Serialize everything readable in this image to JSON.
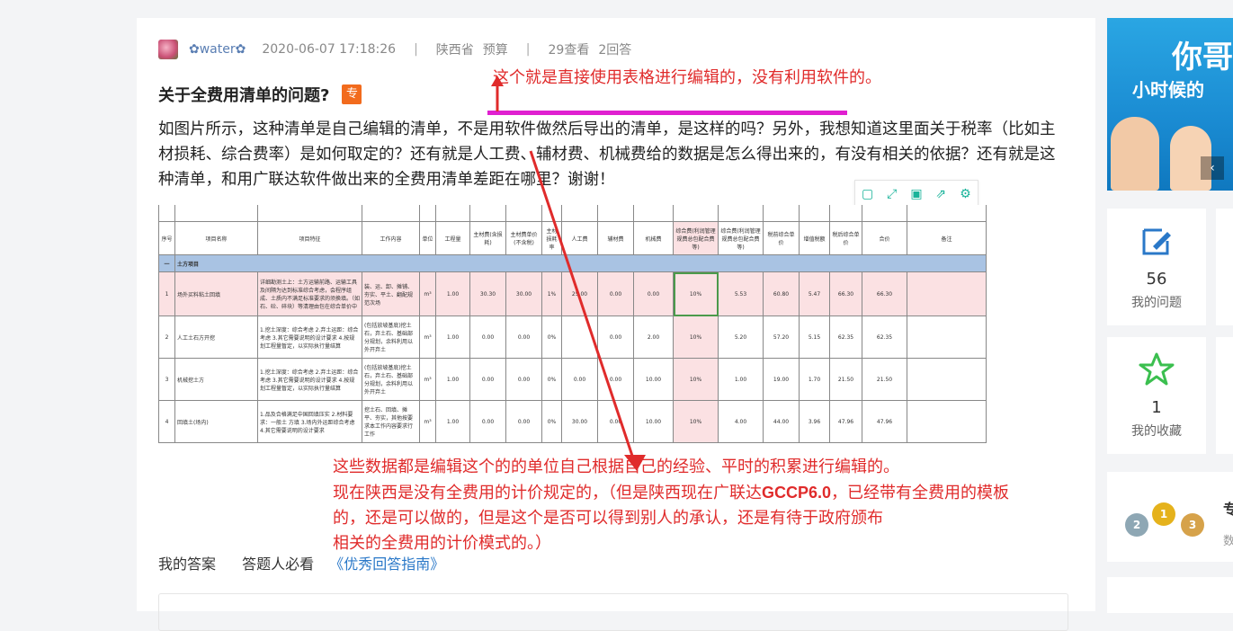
{
  "question": {
    "user": "✿water✿",
    "datetime": "2020-06-07 17:18:26",
    "region": "陕西省",
    "category": "预算",
    "views": "29查看",
    "answers": "2回答",
    "title": "关于全费用清单的问题?",
    "badge": "专",
    "body": "如图片所示，这种清单是自己编辑的清单，不是用软件做然后导出的清单，是这样的吗？另外，我想知道这里面关于税率（比如主材损耗、综合费率）是如何取定的？还有就是人工费、辅材费、机械费给的数据是怎么得出来的，有没有相关的依据？还有就是这种清单，和用广联达软件做出来的全费用清单差距在哪里？谢谢！"
  },
  "annotations": {
    "top": "这个就是直接使用表格进行编辑的，没有利用软件的。",
    "bottom_line1": "这些数据都是编辑这个的的单位自己根据自己的经验、平时的积累进行编辑的。",
    "bottom_line2a": "现在陕西是没有全费用的计价规定的，（但是陕西现在广联达",
    "bottom_line2b": "GCCP6.0",
    "bottom_line2c": "，已经带有全费用的模板",
    "bottom_line3": "的，还是可以做的，但是这个是否可以得到别人的承认，还是有待于政府颁布",
    "bottom_line4": "相关的全费用的计价模式的。）"
  },
  "toolbar_icons": [
    "copy-icon",
    "fullscreen-icon",
    "save-icon",
    "share-icon",
    "settings-icon"
  ],
  "sheet": {
    "headers": [
      "序号",
      "项目名称",
      "项目特征",
      "工作内容",
      "单位",
      "工程量",
      "主材费(含损耗)",
      "主材费单价(不含税)",
      "主材损耗率",
      "人工费",
      "辅材费",
      "机械费",
      "综合费(利润管理规费总包配合费等)",
      "综合费(利润管理规费总包配合费等)",
      "税前综合单价",
      "增值税额",
      "税后综合单价",
      "合价",
      "备注"
    ],
    "category": "土方项目",
    "category_no": "一",
    "rows": [
      [
        "1",
        "场外买料粘土回填",
        "详细勘测土上：土方运输前路、运输工具及间隔为达到标准综合考虑，会程序组成、土质内不满足标准要求的须换填。（如石、砼、碎块）等清理由包在综合单价中",
        "装、运、卸、摊铺、夯实、平土、翻配规范次场",
        "m³",
        "1.00",
        "30.30",
        "30.00",
        "1%",
        "25.00",
        "0.00",
        "0.00",
        "10%",
        "5.53",
        "60.80",
        "5.47",
        "66.30",
        "66.30",
        ""
      ],
      [
        "2",
        "人工土石方开挖",
        "1.挖土深度：综合考虑 2.弃土运距：综合考虑 3.其它需要说明的设计要求 4.按规划工程量暂定，以实际执行量结算",
        "(包括放坡基底)挖土石，弃土石、基础部分规划，余料利用以外开弃土",
        "m³",
        "1.00",
        "0.00",
        "0.00",
        "0%",
        "",
        "0.00",
        "2.00",
        "10%",
        "5.20",
        "57.20",
        "5.15",
        "62.35",
        "62.35",
        ""
      ],
      [
        "3",
        "机械挖土方",
        "1.挖土深度：综合考虑 2.弃土运距：综合考虑 3.其它需要说明的设计要求 4.按规划工程量暂定，以实际执行量结算",
        "(包括放坡基底)挖土石，弃土石、基础部分规划，余料利用以外开弃土",
        "m³",
        "1.00",
        "0.00",
        "0.00",
        "0%",
        "0.00",
        "0.00",
        "10.00",
        "10%",
        "1.00",
        "19.00",
        "1.70",
        "21.50",
        "21.50",
        ""
      ],
      [
        "4",
        "回填土(场内)",
        "1.品及合格满足中国回填压实 2.材料要求：一般土 方填 3.场内外运距综合考虑 4.其它需要说明的设计要求",
        "挖土石、回填、摊平、夯实，其他按要求本工作内容要求行工作",
        "m³",
        "1.00",
        "0.00",
        "0.00",
        "0%",
        "30.00",
        "0.00",
        "10.00",
        "10%",
        "4.00",
        "44.00",
        "3.96",
        "47.96",
        "47.96",
        ""
      ]
    ]
  },
  "answer_bar": {
    "my_answer": "我的答案",
    "must_read": "答题人必看",
    "guide_link": "《优秀回答指南》"
  },
  "sidebar": {
    "banner_text1": "你哥",
    "banner_text2": "小时候的",
    "banner_prev": "‹",
    "my_questions_count": "56",
    "my_questions_label": "我的问题",
    "my_favorites_count": "1",
    "my_favorites_label": "我的收藏",
    "medals": [
      "2",
      "1",
      "3"
    ],
    "expert_title": "专",
    "expert_sub": "数"
  },
  "colors": {
    "annotation_red": "#e02b2b",
    "highlight_magenta": "#e020d0",
    "brand_blue": "#2a78c8",
    "badge_orange": "#f26b1d",
    "icon_teal": "#19b39a"
  }
}
